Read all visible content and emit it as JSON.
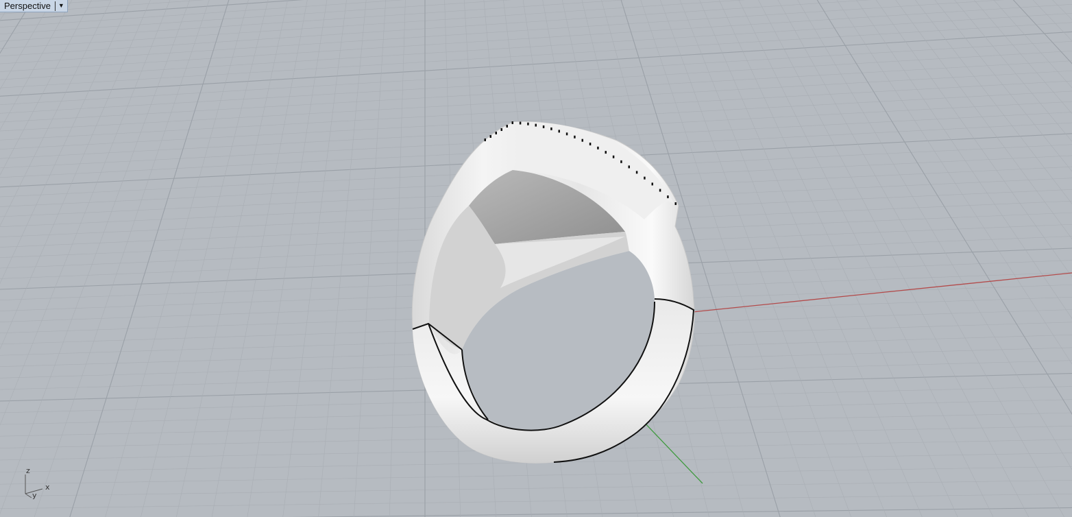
{
  "viewport": {
    "title": "Perspective",
    "menu_icon": "chevron-down-icon"
  },
  "axes_widget": {
    "z_label": "z",
    "x_label": "x",
    "y_label": "y"
  },
  "colors": {
    "background": "#b6bbc1",
    "grid_minor": "#a9aeb4",
    "grid_major": "#9aa0a7",
    "x_axis": "#b34a4a",
    "y_axis": "#3f9a3f",
    "title_bg": "#c9d6e6",
    "model": "#e8e8e8"
  }
}
